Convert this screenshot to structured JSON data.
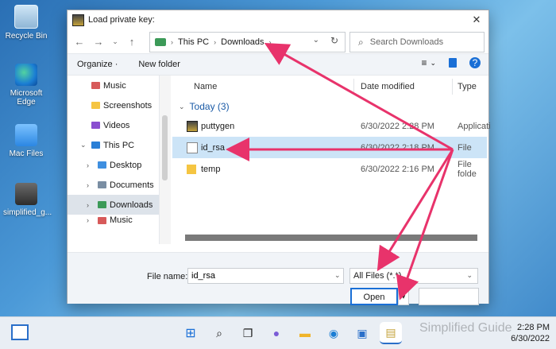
{
  "desktop": {
    "icons": [
      {
        "label": "Recycle Bin"
      },
      {
        "label": "Microsoft Edge"
      },
      {
        "label": "Mac Files"
      },
      {
        "label": "simplified_g..."
      }
    ]
  },
  "dialog": {
    "title": "Load private key:",
    "close": "✕",
    "nav": {
      "back": "←",
      "forward": "→",
      "recent": "⌄",
      "up": "↑"
    },
    "breadcrumb": [
      "This PC",
      "Downloads"
    ],
    "search_placeholder": "Search Downloads",
    "toolbar": {
      "organize": "Organize ·",
      "new_folder": "New folder",
      "view_icon": "≡",
      "help": "?"
    },
    "sidebar": [
      {
        "label": "Music",
        "expand": ""
      },
      {
        "label": "Screenshots",
        "expand": ""
      },
      {
        "label": "Videos",
        "expand": ""
      },
      {
        "label": "This PC",
        "expand": "⌄"
      },
      {
        "label": "Desktop",
        "expand": "›"
      },
      {
        "label": "Documents",
        "expand": "›"
      },
      {
        "label": "Downloads",
        "expand": "›",
        "selected": true
      },
      {
        "label": "Music",
        "expand": "›"
      }
    ],
    "columns": {
      "name": "Name",
      "date": "Date modified",
      "type": "Type"
    },
    "group": {
      "label": "Today (3)"
    },
    "files": [
      {
        "name": "puttygen",
        "date": "6/30/2022 2:28 PM",
        "type": "Applicati"
      },
      {
        "name": "id_rsa",
        "date": "6/30/2022 2:18 PM",
        "type": "File",
        "selected": true
      },
      {
        "name": "temp",
        "date": "6/30/2022 2:16 PM",
        "type": "File folde"
      }
    ],
    "footer": {
      "file_name_label": "File name:",
      "file_name_value": "id_rsa",
      "filter": "All Files (*.*)",
      "open": "Open",
      "split": "▾",
      "cancel": ""
    }
  },
  "taskbar": {
    "time": "2:28 PM",
    "date": "6/30/2022",
    "watermark": "Simplified Guide"
  },
  "colors": {
    "accent": "#1a6fd6",
    "annotation": "#e8336b",
    "selection": "#cce4f7"
  }
}
